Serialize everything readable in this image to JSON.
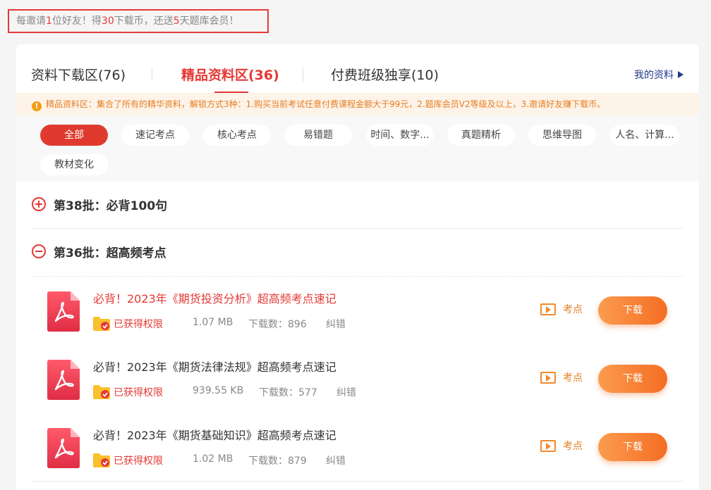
{
  "invite": {
    "p1": "每邀请",
    "n1": "1",
    "p2": "位好友！得",
    "n2": "30",
    "p3": "下载币，还送",
    "n3": "5",
    "p4": "天题库会员！"
  },
  "tabs": [
    {
      "label": "资料下载区(76)"
    },
    {
      "label": "精品资料区(36)"
    },
    {
      "label": "付费班级独享(10)"
    }
  ],
  "active_tab": "精品资料区(36)",
  "my_resources": "我的资料",
  "notice": "精品资料区：集合了所有的精华资料，解锁方式3种：1.购买当前考试任意付费课程金额大于99元，2.题库会员V2等级及以上，3.邀请好友赚下载币。",
  "filters": [
    {
      "label": "全部"
    },
    {
      "label": "速记考点"
    },
    {
      "label": "核心考点"
    },
    {
      "label": "易错题"
    },
    {
      "label": "时间、数字..."
    },
    {
      "label": "真题精析"
    },
    {
      "label": "思维导图"
    },
    {
      "label": "人名、计算..."
    },
    {
      "label": "教材变化"
    }
  ],
  "active_filter": "全部",
  "batches": [
    {
      "title": "第38批：必背100句",
      "expanded": false
    },
    {
      "title": "第36批：超高频考点",
      "expanded": true
    }
  ],
  "files": [
    {
      "title": "必背！2023年《期货投资分析》超高频考点速记",
      "permission": "已获得权限",
      "size": "1.07 MB",
      "downloads": "下载数：896",
      "report": "纠错",
      "tag": "考点",
      "download": "下载",
      "highlighted": true
    },
    {
      "title": "必背！2023年《期货法律法规》超高频考点速记",
      "permission": "已获得权限",
      "size": "939.55 KB",
      "downloads": "下载数：577",
      "report": "纠错",
      "tag": "考点",
      "download": "下载",
      "highlighted": false
    },
    {
      "title": "必背！2023年《期货基础知识》超高频考点速记",
      "permission": "已获得权限",
      "size": "1.02 MB",
      "downloads": "下载数：879",
      "report": "纠错",
      "tag": "考点",
      "download": "下载",
      "highlighted": false
    }
  ],
  "colors": {
    "accent": "#e53935",
    "download_start": "#fb9c4f",
    "download_end": "#f46d23",
    "notice_bg": "#fdf3e8",
    "link": "#1f3a8a"
  },
  "icons": {
    "toggle_expand": "plus-circle-icon",
    "toggle_collapse": "minus-circle-icon",
    "file": "pdf-file-icon",
    "permission": "folder-check-icon",
    "tag": "play-icon",
    "notice": "info-icon",
    "my_resources": "triangle-right-icon"
  }
}
